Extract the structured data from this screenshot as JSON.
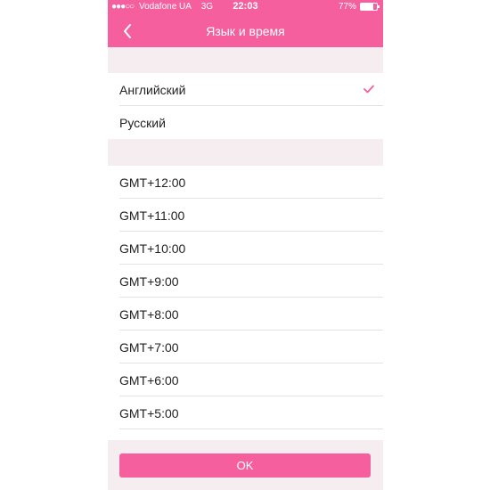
{
  "status_bar": {
    "signal_dots": "●●●○○",
    "carrier": "Vodafone UA",
    "network": "3G",
    "time": "22:03",
    "battery": "77%",
    "battery_level": 0.77
  },
  "nav": {
    "title": "Язык и время",
    "back_icon": "chevron-left-icon"
  },
  "languages": [
    {
      "label": "Английский",
      "selected": true
    },
    {
      "label": "Русский",
      "selected": false
    }
  ],
  "timezones": [
    "GMT+12:00",
    "GMT+11:00",
    "GMT+10:00",
    "GMT+9:00",
    "GMT+8:00",
    "GMT+7:00",
    "GMT+6:00",
    "GMT+5:00"
  ],
  "footer": {
    "ok_label": "OK"
  },
  "colors": {
    "accent": "#f55f9d",
    "section_background": "#f6edf1"
  }
}
